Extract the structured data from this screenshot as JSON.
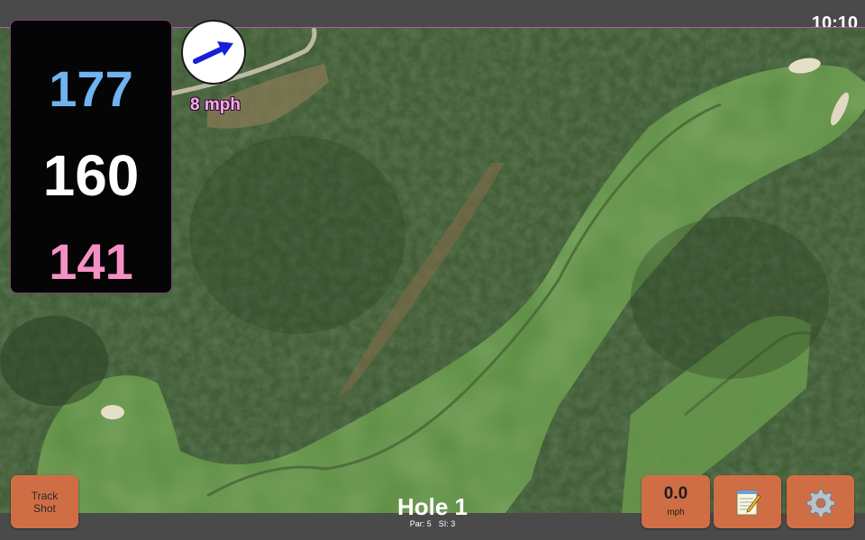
{
  "status_bar": {
    "time": "10:10"
  },
  "distances": {
    "back": "177",
    "middle": "160",
    "front": "141"
  },
  "distance_colors": {
    "back": "#6fb3f0",
    "middle": "#ffffff",
    "front": "#f590c5"
  },
  "wind": {
    "speed_label": "8 mph",
    "arrow_icon": "wind-direction-arrow-icon"
  },
  "hole": {
    "title": "Hole 1",
    "par": "Par: 5",
    "si": "SI: 3"
  },
  "buttons": {
    "track_shot_line1": "Track",
    "track_shot_line2": "Shot",
    "speed_value": "0.0",
    "speed_unit": "mph",
    "notes_icon": "notepad-icon",
    "settings_icon": "gear-icon"
  },
  "colors": {
    "button": "#cf6e45",
    "bar": "#4a4a4a",
    "panel": "#050505"
  }
}
